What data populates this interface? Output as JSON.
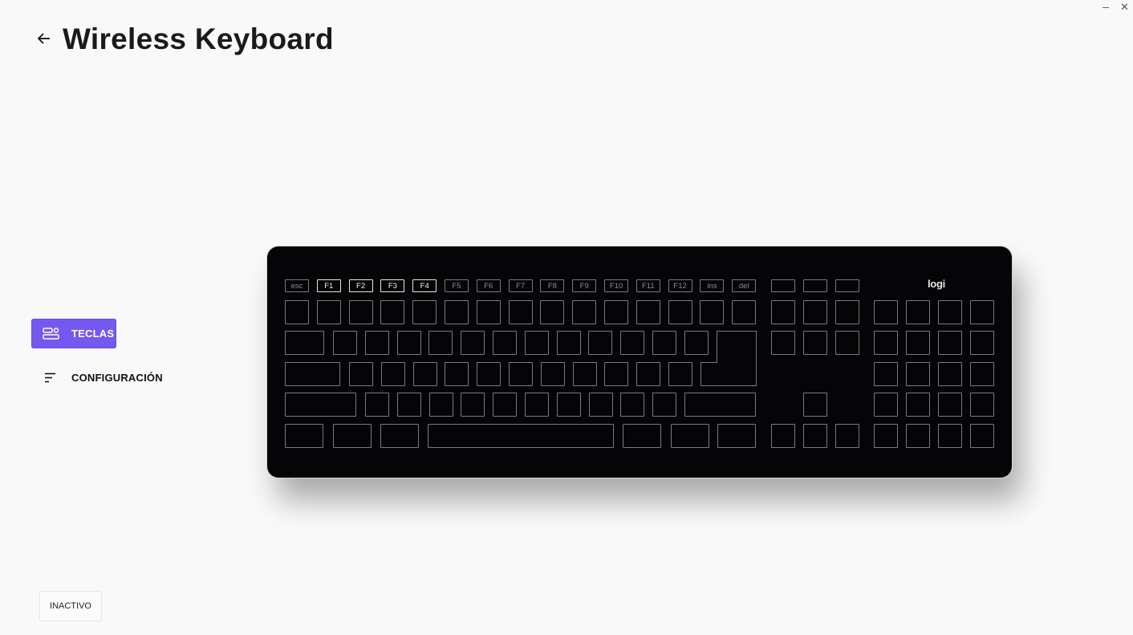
{
  "window": {
    "minimize_glyph": "–",
    "close_glyph": "✕"
  },
  "header": {
    "title": "Wireless Keyboard"
  },
  "sidebar": {
    "items": [
      {
        "label": "TECLAS",
        "active": true,
        "icon": "keys-icon"
      },
      {
        "label": "CONFIGURACIÓN",
        "active": false,
        "icon": "settings-lines-icon"
      }
    ]
  },
  "footer": {
    "status_label": "INACTIVO"
  },
  "keyboard": {
    "logo": "logi",
    "function_keys": [
      "esc",
      "F1",
      "F2",
      "F3",
      "F4",
      "F5",
      "F6",
      "F7",
      "F8",
      "F9",
      "F10",
      "F11",
      "F12",
      "ins",
      "del"
    ],
    "highlighted_keys": [
      "F1",
      "F2",
      "F3",
      "F4"
    ]
  },
  "colors": {
    "accent": "#7558f0",
    "keyboard_body": "#050407",
    "background": "#f9f9f9"
  }
}
